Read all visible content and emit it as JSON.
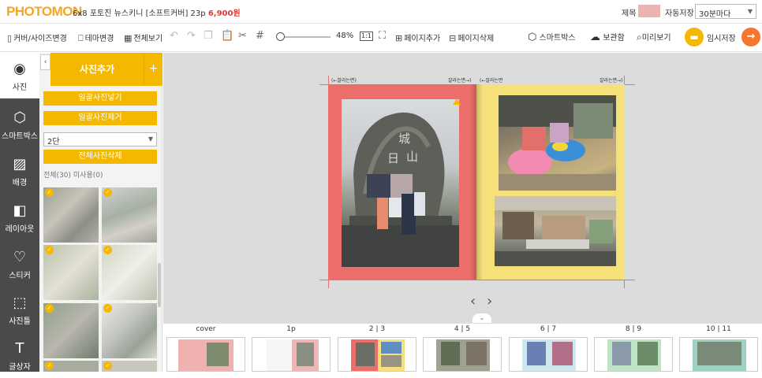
{
  "header": {
    "logo": "PHOTOMON",
    "product": "6x8 포토진 뉴스키니 [소프트커버] 23p",
    "price": "6,900원",
    "title_label": "제목",
    "autosave_label": "자동저장",
    "autosave_value": "30분마다"
  },
  "toolbar": {
    "cover_size": "커버/사이즈변경",
    "theme_change": "테마변경",
    "view_all": "전체보기",
    "zoom_value": "48%",
    "ratio_label": "1:1",
    "page_add": "페이지추가",
    "page_delete": "페이지삭제",
    "smartbox": "스마트박스",
    "storage": "보관함",
    "preview": "미리보기",
    "temp_save": "임시저장"
  },
  "leftbar": {
    "items": [
      {
        "label": "사진",
        "icon": "camera-icon"
      },
      {
        "label": "스마트박스",
        "icon": "smartbox-icon"
      },
      {
        "label": "배경",
        "icon": "image-icon"
      },
      {
        "label": "레이아웃",
        "icon": "layout-icon"
      },
      {
        "label": "스티커",
        "icon": "heart-icon"
      },
      {
        "label": "사진틀",
        "icon": "frame-icon"
      },
      {
        "label": "글상자",
        "icon": "textbox-icon"
      }
    ]
  },
  "panel": {
    "title": "사진추가",
    "add_symbol": "+",
    "bulk_insert": "일괄사진넣기",
    "bulk_remove": "일괄사진제거",
    "column_select": "2단",
    "delete_all": "전체사진삭제",
    "stats": "전체(30) 미사용(0)"
  },
  "canvas": {
    "cut_label_left": "(←잘라는면)",
    "cut_label_left2": "잘라는면→)",
    "cut_label_right": "(←잘라는면",
    "cut_label_right2": "잘라는면→)"
  },
  "filmstrip": {
    "labels": [
      "cover",
      "1p",
      "2 | 3",
      "4 | 5",
      "6 | 7",
      "8 | 9",
      "10 | 11"
    ]
  },
  "colors": {
    "accent": "#f5b800",
    "page_left": "#ec6e6a",
    "page_right": "#f5e07a",
    "next_button": "#f4762f",
    "price": "#e53935"
  }
}
